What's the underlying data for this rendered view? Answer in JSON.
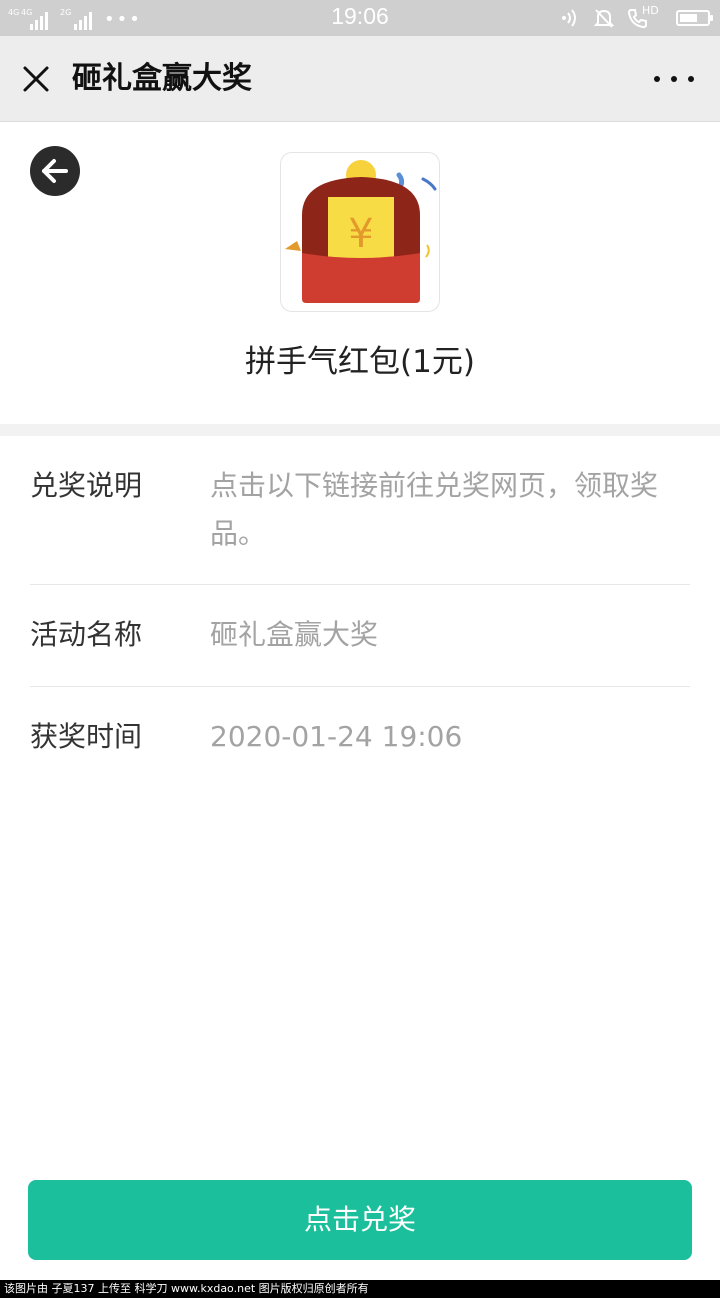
{
  "status_bar": {
    "network_tags": [
      "4G",
      "4G",
      "2G"
    ],
    "more_dots": "•••",
    "time": "19:06",
    "hd_label": "HD",
    "icons": [
      "nfc-icon",
      "bell-muted-icon",
      "hd-call-icon",
      "battery-icon"
    ],
    "battery_level": 0.65
  },
  "nav": {
    "title": "砸礼盒赢大奖",
    "close_icon": "close-icon",
    "more_icon": "more-icon"
  },
  "prize": {
    "name": "拼手气红包(1元)",
    "currency_symbol": "¥",
    "colors": {
      "envelope_top": "#8e2519",
      "envelope_bottom": "#cf3c30",
      "card": "#f8dc46",
      "coin": "#f7d23c",
      "symbol": "#e39a2c"
    }
  },
  "details": {
    "rows": [
      {
        "label": "兑奖说明",
        "value": "点击以下链接前往兑奖网页，领取奖品。"
      },
      {
        "label": "活动名称",
        "value": "砸礼盒赢大奖"
      },
      {
        "label": "获奖时间",
        "value": "2020-01-24 19:06"
      }
    ]
  },
  "action": {
    "redeem_label": "点击兑奖",
    "color": "#1cbf9b"
  },
  "watermark": {
    "text": "该图片由 子夏137 上传至 科学刀 www.kxdao.net 图片版权归原创者所有"
  }
}
